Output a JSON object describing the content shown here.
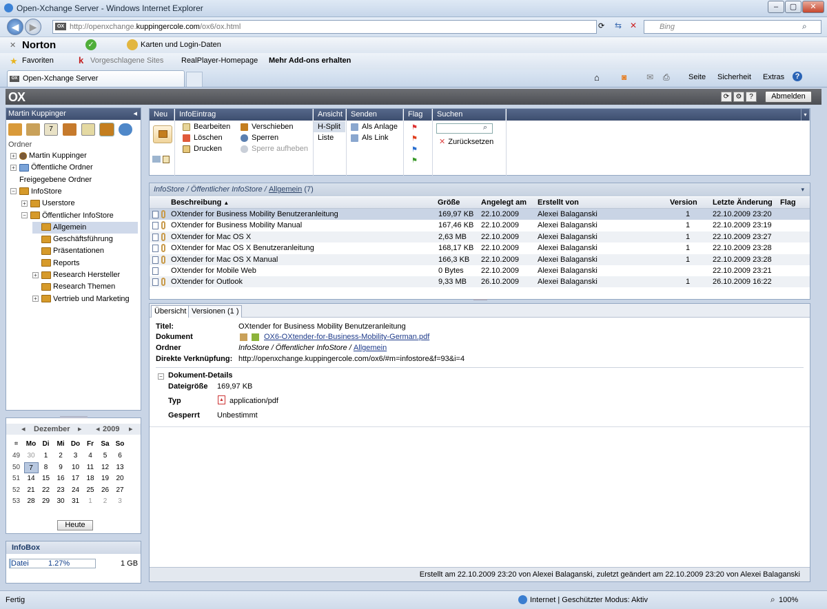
{
  "browser": {
    "window_title": "Open-Xchange Server - Windows Internet Explorer",
    "address": {
      "prefix": "http://openxchange.",
      "host": "kuppingercole.com",
      "path": "/ox6/ox.html"
    },
    "search_placeholder": "Bing",
    "toolbar": {
      "norton": "Norton",
      "karten": "Karten und Login-Daten"
    },
    "favorites": {
      "label": "Favoriten",
      "items": [
        "Vorgeschlagene Sites",
        "RealPlayer-Homepage",
        "Mehr Add-ons erhalten"
      ]
    },
    "tab_title": "Open-Xchange Server",
    "commands": [
      "Seite",
      "Sicherheit",
      "Extras"
    ],
    "status": {
      "left": "Fertig",
      "zone": "Internet | Geschützter Modus: Aktiv",
      "zoom": "100%"
    }
  },
  "ox": {
    "logo": "OX",
    "logout_label": "Abmelden",
    "left": {
      "user": "Martin Kuppinger",
      "folders_label": "Ordner",
      "tree": [
        {
          "label": "Martin Kuppinger",
          "level": 0,
          "exp": "+",
          "icon": "user"
        },
        {
          "label": "Öffentliche Ordner",
          "level": 0,
          "exp": "+",
          "icon": "blue"
        },
        {
          "label": "Freigegebene Ordner",
          "level": 0,
          "exp": "",
          "icon": "none"
        },
        {
          "label": "InfoStore",
          "level": 0,
          "exp": "−",
          "icon": "orange"
        },
        {
          "label": "Userstore",
          "level": 1,
          "exp": "+",
          "icon": "orange"
        },
        {
          "label": "Öffentlicher InfoStore",
          "level": 1,
          "exp": "−",
          "icon": "orange"
        },
        {
          "label": "Allgemein",
          "level": 2,
          "exp": "",
          "icon": "orange",
          "selected": true
        },
        {
          "label": "Geschäftsführung",
          "level": 2,
          "exp": "",
          "icon": "orange"
        },
        {
          "label": "Präsentationen",
          "level": 2,
          "exp": "",
          "icon": "orange"
        },
        {
          "label": "Reports",
          "level": 2,
          "exp": "",
          "icon": "orange"
        },
        {
          "label": "Research Hersteller",
          "level": 2,
          "exp": "+",
          "icon": "orange"
        },
        {
          "label": "Research Themen",
          "level": 2,
          "exp": "",
          "icon": "orange"
        },
        {
          "label": "Vertrieb und Marketing",
          "level": 2,
          "exp": "+",
          "icon": "orange"
        }
      ]
    },
    "calendar": {
      "month": "Dezember",
      "year": "2009",
      "weekdays": [
        "Mo",
        "Di",
        "Mi",
        "Do",
        "Fr",
        "Sa",
        "So"
      ],
      "weeks": [
        {
          "wk": "49",
          "days": [
            "30",
            "1",
            "2",
            "3",
            "4",
            "5",
            "6"
          ]
        },
        {
          "wk": "50",
          "days": [
            "7",
            "8",
            "9",
            "10",
            "11",
            "12",
            "13"
          ]
        },
        {
          "wk": "51",
          "days": [
            "14",
            "15",
            "16",
            "17",
            "18",
            "19",
            "20"
          ]
        },
        {
          "wk": "52",
          "days": [
            "21",
            "22",
            "23",
            "24",
            "25",
            "26",
            "27"
          ]
        },
        {
          "wk": "53",
          "days": [
            "28",
            "29",
            "30",
            "31",
            "1",
            "2",
            "3"
          ]
        }
      ],
      "today_label": "Heute"
    },
    "infobox": {
      "title": "InfoBox",
      "label": "Datei",
      "percent": "1.27%",
      "quota": "1 GB",
      "fill": 0.0127
    },
    "toolbar": {
      "sections": {
        "neu": "Neu",
        "infoeintrag": "InfoEintrag",
        "ansicht": "Ansicht",
        "senden": "Senden",
        "flag": "Flag",
        "suchen": "Suchen"
      },
      "bearbeiten": "Bearbeiten",
      "loeschen": "Löschen",
      "drucken": "Drucken",
      "verschieben": "Verschieben",
      "sperren": "Sperren",
      "sperre_aufheben": "Sperre aufheben",
      "hsplit": "H-Split",
      "liste": "Liste",
      "als_anlage": "Als Anlage",
      "als_link": "Als Link",
      "zuruecksetzen": "Zurücksetzen"
    },
    "list": {
      "path_a": "InfoStore / Öffentlicher InfoStore /",
      "path_link": "Allgemein",
      "count": "(7)",
      "headers": {
        "beschreibung": "Beschreibung",
        "groesse": "Größe",
        "angelegt": "Angelegt am",
        "erstellt": "Erstellt von",
        "version": "Version",
        "aenderung": "Letzte Änderung",
        "flag": "Flag"
      },
      "rows": [
        {
          "name": "OXtender for Business Mobility Benutzeranleitung",
          "size": "169,97 KB",
          "created": "22.10.2009",
          "by": "Alexei Balaganski",
          "version": "1",
          "modified": "22.10.2009 23:20"
        },
        {
          "name": "OXtender for Business Mobility Manual",
          "size": "167,46 KB",
          "created": "22.10.2009",
          "by": "Alexei Balaganski",
          "version": "1",
          "modified": "22.10.2009 23:19"
        },
        {
          "name": "OXtender for Mac OS X",
          "size": "2,63 MB",
          "created": "22.10.2009",
          "by": "Alexei Balaganski",
          "version": "1",
          "modified": "22.10.2009 23:27"
        },
        {
          "name": "OXtender for Mac OS X Benutzeranleitung",
          "size": "168,17 KB",
          "created": "22.10.2009",
          "by": "Alexei Balaganski",
          "version": "1",
          "modified": "22.10.2009 23:28"
        },
        {
          "name": "OXtender for Mac OS X Manual",
          "size": "166,3 KB",
          "created": "22.10.2009",
          "by": "Alexei Balaganski",
          "version": "1",
          "modified": "22.10.2009 23:28"
        },
        {
          "name": "OXtender for Mobile Web",
          "size": "0 Bytes",
          "created": "22.10.2009",
          "by": "Alexei Balaganski",
          "version": "",
          "modified": "22.10.2009 23:21"
        },
        {
          "name": "OXtender for Outlook",
          "size": "9,33 MB",
          "created": "26.10.2009",
          "by": "Alexei Balaganski",
          "version": "1",
          "modified": "26.10.2009 16:22"
        }
      ]
    },
    "detail": {
      "tab_overview": "Übersicht",
      "tab_versions": "Versionen  (1 )",
      "labels": {
        "titel": "Titel:",
        "dokument": "Dokument",
        "ordner": "Ordner",
        "link": "Direkte Verknüpfung:",
        "details": "Dokument-Details",
        "groesse": "Dateigröße",
        "typ": "Typ",
        "gesperrt": "Gesperrt"
      },
      "titel": "OXtender for Business Mobility Benutzeranleitung",
      "dokument": "OX6-OXtender-for-Business-Mobility-German.pdf",
      "ordner_a": "InfoStore / Öffentlicher InfoStore /",
      "ordner_link": "Allgemein",
      "link": "http://openxchange.kuppingercole.com/ox6/#m=infostore&f=93&i=4",
      "groesse": "169,97 KB",
      "typ": "application/pdf",
      "gesperrt": "Unbestimmt",
      "footer": "Erstellt am 22.10.2009 23:20 von Alexei Balaganski, zuletzt geändert am 22.10.2009 23:20 von Alexei Balaganski"
    }
  }
}
